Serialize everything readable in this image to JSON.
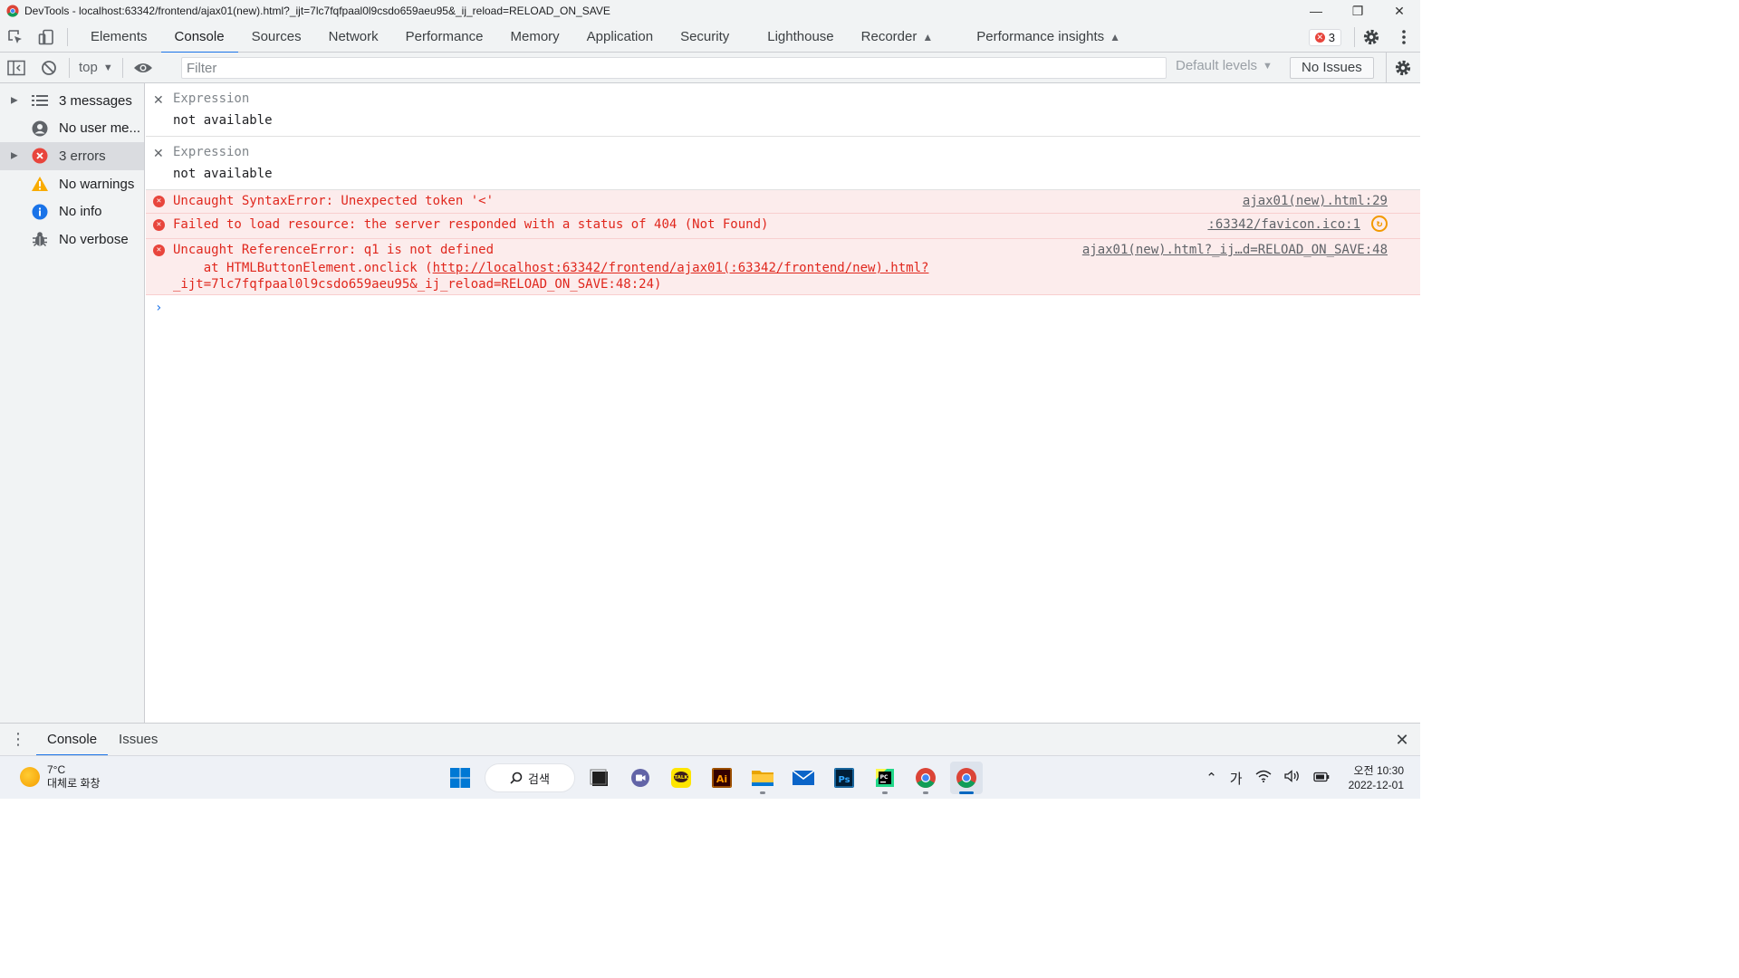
{
  "window": {
    "title": "DevTools - localhost:63342/frontend/ajax01(new).html?_ijt=7lc7fqfpaal0l9csdo659aeu95&_ij_reload=RELOAD_ON_SAVE"
  },
  "tabs": [
    {
      "label": "Elements"
    },
    {
      "label": "Console"
    },
    {
      "label": "Sources"
    },
    {
      "label": "Network"
    },
    {
      "label": "Performance"
    },
    {
      "label": "Memory"
    },
    {
      "label": "Application"
    },
    {
      "label": "Security"
    },
    {
      "label": "Lighthouse"
    },
    {
      "label": "Recorder"
    },
    {
      "label": "Performance insights"
    }
  ],
  "error_count": "3",
  "toolbar": {
    "context": "top",
    "filter_placeholder": "Filter",
    "levels": "Default levels",
    "issues": "No Issues"
  },
  "sidebar": {
    "items": [
      {
        "label": "3 messages"
      },
      {
        "label": "No user me..."
      },
      {
        "label": "3 errors"
      },
      {
        "label": "No warnings"
      },
      {
        "label": "No info"
      },
      {
        "label": "No verbose"
      }
    ]
  },
  "expressions": [
    {
      "label": "Expression",
      "value": "not available"
    },
    {
      "label": "Expression",
      "value": "not available"
    }
  ],
  "errors": [
    {
      "message": "Uncaught SyntaxError: Unexpected token '<'",
      "source": "ajax01(new).html:29"
    },
    {
      "message": "Failed to load resource: the server responded with a status of 404 (Not Found)",
      "source": ":63342/favicon.ico:1"
    },
    {
      "message": "Uncaught ReferenceError: q1 is not defined",
      "source": "ajax01(new).html?_ij…d=RELOAD_ON_SAVE:48",
      "stack_prefix": "    at HTMLButtonElement.onclick (",
      "stack_link": "http://localhost:63342/frontend/ajax01(:63342/frontend/new).html?",
      "stack_line2": "_ijt=7lc7fqfpaal0l9csdo659aeu95&_ij_reload=RELOAD_ON_SAVE:48:24)"
    }
  ],
  "prompt_symbol": "›",
  "drawer": {
    "tabs": [
      {
        "label": "Console"
      },
      {
        "label": "Issues"
      }
    ]
  },
  "taskbar": {
    "weather_temp": "7°C",
    "weather_desc": "대체로 화창",
    "search_label": "검색",
    "ime": "가",
    "time": "오전 10:30",
    "date": "2022-12-01"
  },
  "colors": {
    "error_red": "#e0271d",
    "error_bg": "#fcecec",
    "accent": "#1a73e8"
  }
}
